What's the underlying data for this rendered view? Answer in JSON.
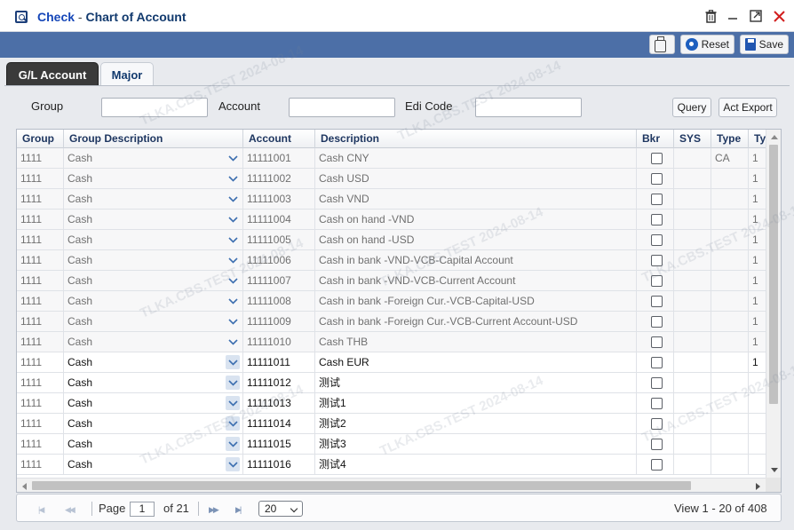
{
  "window": {
    "title_prefix": "Check",
    "title_sep": " - ",
    "title_main": "Chart of Account"
  },
  "toolbar": {
    "reset_label": "Reset",
    "save_label": "Save"
  },
  "tabs": [
    {
      "label": "G/L Account",
      "active": true
    },
    {
      "label": "Major",
      "active": false
    }
  ],
  "filters": {
    "group_label": "Group",
    "account_label": "Account",
    "edi_label": "Edi Code",
    "group_value": "",
    "account_value": "",
    "edi_value": "",
    "query_label": "Query",
    "export_label": "Act Export"
  },
  "grid": {
    "columns": [
      "Group",
      "Group Description",
      "Account",
      "Description",
      "Bkr",
      "SYS",
      "Type",
      "Ty"
    ],
    "rows": [
      {
        "group": "1111",
        "group_desc": "Cash",
        "account": "11111001",
        "description": "Cash CNY",
        "bkr": false,
        "sys": "",
        "type": "CA",
        "ty": "1",
        "style": "old"
      },
      {
        "group": "1111",
        "group_desc": "Cash",
        "account": "11111002",
        "description": "Cash USD",
        "bkr": false,
        "sys": "",
        "type": "",
        "ty": "1",
        "style": "old"
      },
      {
        "group": "1111",
        "group_desc": "Cash",
        "account": "11111003",
        "description": "Cash VND",
        "bkr": false,
        "sys": "",
        "type": "",
        "ty": "1",
        "style": "old"
      },
      {
        "group": "1111",
        "group_desc": "Cash",
        "account": "11111004",
        "description": "Cash on hand -VND",
        "bkr": false,
        "sys": "",
        "type": "",
        "ty": "1",
        "style": "old"
      },
      {
        "group": "1111",
        "group_desc": "Cash",
        "account": "11111005",
        "description": "Cash on hand -USD",
        "bkr": false,
        "sys": "",
        "type": "",
        "ty": "1",
        "style": "old"
      },
      {
        "group": "1111",
        "group_desc": "Cash",
        "account": "11111006",
        "description": "Cash in bank -VND-VCB-Capital Account",
        "bkr": false,
        "sys": "",
        "type": "",
        "ty": "1",
        "style": "old"
      },
      {
        "group": "1111",
        "group_desc": "Cash",
        "account": "11111007",
        "description": "Cash in bank -VND-VCB-Current Account",
        "bkr": false,
        "sys": "",
        "type": "",
        "ty": "1",
        "style": "old"
      },
      {
        "group": "1111",
        "group_desc": "Cash",
        "account": "11111008",
        "description": "Cash in bank -Foreign Cur.-VCB-Capital-USD",
        "bkr": false,
        "sys": "",
        "type": "",
        "ty": "1",
        "style": "old"
      },
      {
        "group": "1111",
        "group_desc": "Cash",
        "account": "11111009",
        "description": "Cash in bank -Foreign Cur.-VCB-Current Account-USD",
        "bkr": false,
        "sys": "",
        "type": "",
        "ty": "1",
        "style": "old"
      },
      {
        "group": "1111",
        "group_desc": "Cash",
        "account": "11111010",
        "description": "Cash THB",
        "bkr": false,
        "sys": "",
        "type": "",
        "ty": "1",
        "style": "old"
      },
      {
        "group": "1111",
        "group_desc": "Cash",
        "account": "11111011",
        "description": "Cash EUR",
        "bkr": false,
        "sys": "",
        "type": "",
        "ty": "1",
        "style": "new"
      },
      {
        "group": "1111",
        "group_desc": "Cash",
        "account": "11111012",
        "description": "测试",
        "bkr": false,
        "sys": "",
        "type": "",
        "ty": "",
        "style": "new"
      },
      {
        "group": "1111",
        "group_desc": "Cash",
        "account": "11111013",
        "description": "测试1",
        "bkr": false,
        "sys": "",
        "type": "",
        "ty": "",
        "style": "new"
      },
      {
        "group": "1111",
        "group_desc": "Cash",
        "account": "11111014",
        "description": "测试2",
        "bkr": false,
        "sys": "",
        "type": "",
        "ty": "",
        "style": "new"
      },
      {
        "group": "1111",
        "group_desc": "Cash",
        "account": "11111015",
        "description": "测试3",
        "bkr": false,
        "sys": "",
        "type": "",
        "ty": "",
        "style": "new"
      },
      {
        "group": "1111",
        "group_desc": "Cash",
        "account": "11111016",
        "description": "测试4",
        "bkr": false,
        "sys": "",
        "type": "",
        "ty": "",
        "style": "new"
      }
    ]
  },
  "pager": {
    "page_label": "Page",
    "page_value": "1",
    "of_label": "of 21",
    "page_size": "20",
    "view_label": "View  1 - 20  of 408"
  },
  "watermark": "TLKA.CBS.TEST 2024-08-14",
  "colors": {
    "toolbar_bg": "#4c6fa7",
    "title_accent": "#1546b8",
    "close_icon": "#d21f1f"
  }
}
